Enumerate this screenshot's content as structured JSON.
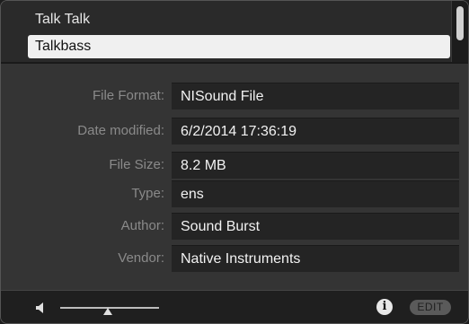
{
  "list": {
    "items": [
      {
        "label": "Talk Talk",
        "selected": false
      },
      {
        "label": "Talkbass",
        "selected": true
      }
    ]
  },
  "info": {
    "fields": [
      {
        "label": "File Format:",
        "value": "NISound File"
      },
      {
        "label": "Date modified:",
        "value": "6/2/2014 17:36:19"
      },
      {
        "label": "File Size:",
        "value": "8.2 MB"
      },
      {
        "label": "Type:",
        "value": "ens"
      },
      {
        "label": "Author:",
        "value": "Sound Burst"
      },
      {
        "label": "Vendor:",
        "value": "Native Instruments"
      }
    ]
  },
  "bottombar": {
    "volume_icon": "speaker-icon",
    "info_icon": "info-icon",
    "info_glyph": "i",
    "edit_label": "EDIT"
  }
}
